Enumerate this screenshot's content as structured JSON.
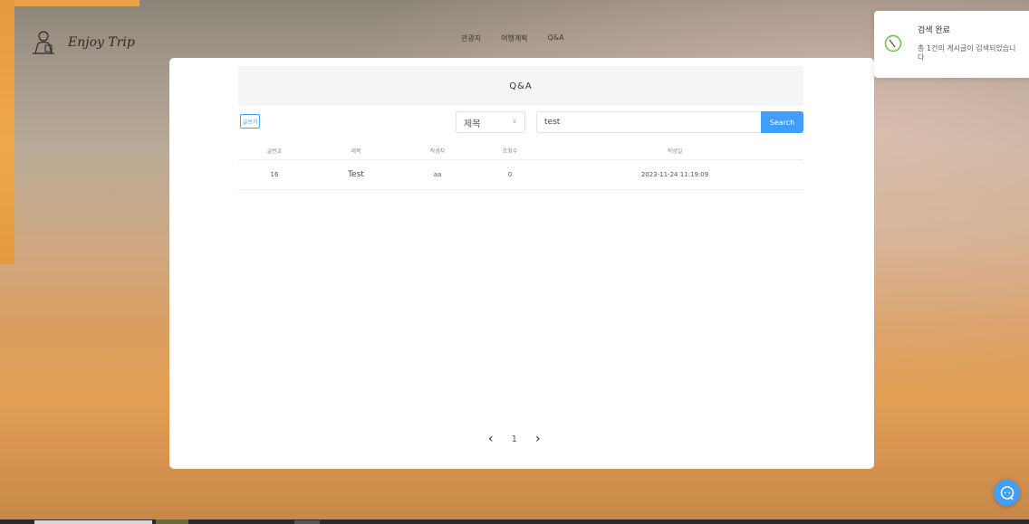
{
  "header": {
    "logo_text": "Enjoy Trip",
    "nav": [
      "관광지",
      "여행계획",
      "Q&A"
    ]
  },
  "board": {
    "title": "Q&A",
    "write_button": "글쓰기",
    "search": {
      "field_selected": "제목",
      "query": "test",
      "button": "Search"
    },
    "columns": [
      "글번호",
      "제목",
      "작성자",
      "조회수",
      "작성일"
    ],
    "rows": [
      {
        "no": "16",
        "title": "Test",
        "author": "aa",
        "views": "0",
        "date": "2023-11-24 11:19:09"
      }
    ],
    "pagination": {
      "prev": "‹",
      "current": "1",
      "next": "›"
    }
  },
  "toast": {
    "title": "검색 완료",
    "message": "총 1건의 게시글이 검색되었습니다"
  },
  "colors": {
    "accent": "#409eff",
    "toast_icon": "#67c23a"
  }
}
